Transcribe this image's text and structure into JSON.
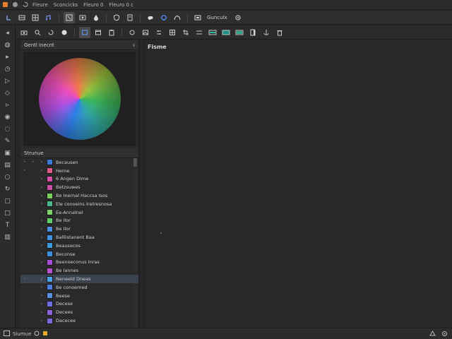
{
  "menubar": {
    "icons": [
      "app-logo-icon",
      "cloud-icon",
      "refresh-icon"
    ],
    "items": [
      "Fleure",
      "Sconcicks",
      "Fleuro 0",
      "Fleuro 0 c"
    ]
  },
  "toolbar": {
    "label_1": "Gunculx"
  },
  "panel": {
    "header": "Gentl inecnt",
    "close": "∨",
    "layers_header": "Strunue"
  },
  "layers": [
    {
      "label": "Becausen",
      "color": "#3b78d8"
    },
    {
      "label": "Heme",
      "color": "#e05a8a"
    },
    {
      "label": "6 Angen Dime",
      "color": "#d94fa6"
    },
    {
      "label": "Betzsuwes",
      "color": "#cc4fa6"
    },
    {
      "label": "Be Inernal Haccsa Isos",
      "color": "#7ad05a"
    },
    {
      "label": "Ele conoeins Iretresnosa",
      "color": "#47b98a"
    },
    {
      "label": "Ee-Annalnel",
      "color": "#7ed06a"
    },
    {
      "label": "Be Ilor",
      "color": "#5fcf6b"
    },
    {
      "label": "Be Ilor",
      "color": "#4b8de0"
    },
    {
      "label": "Balliistanent Baa",
      "color": "#3f8fdb"
    },
    {
      "label": "Beausecos",
      "color": "#3a9bde"
    },
    {
      "label": "Beconse",
      "color": "#3e8ee0"
    },
    {
      "label": "Beenoeconus Inras",
      "color": "#a64fd8"
    },
    {
      "label": "Be Iannes",
      "color": "#b454cf"
    },
    {
      "label": "Neneeld Dneas",
      "color": "#49a6e6"
    },
    {
      "label": "Be conoemed",
      "color": "#4d7fe0"
    },
    {
      "label": "Beese",
      "color": "#5a8fe2"
    },
    {
      "label": "Decese",
      "color": "#6d6ee3"
    },
    {
      "label": "Decees",
      "color": "#8d62d8"
    },
    {
      "label": "Dacecee",
      "color": "#7b6bd9"
    }
  ],
  "canvas": {
    "title": "Fisme"
  },
  "statusbar": {
    "left_text": "Siumue"
  },
  "colors": {
    "accent": "#3b78d8",
    "selected_row": "#3c4350",
    "background": "#262626"
  }
}
